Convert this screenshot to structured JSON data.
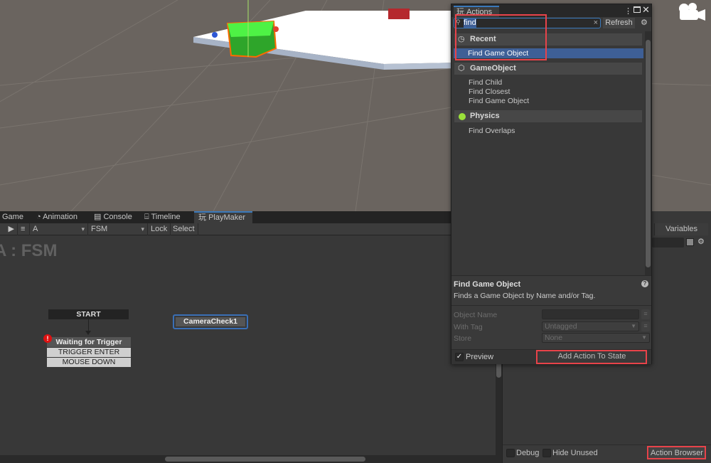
{
  "scene": {
    "camera_icon": "camera-gizmo-icon"
  },
  "bottom_tabs": [
    {
      "label": "Game",
      "icon": ""
    },
    {
      "label": "Animation",
      "icon": "clock-icon"
    },
    {
      "label": "Console",
      "icon": "console-icon"
    },
    {
      "label": "Timeline",
      "icon": "film-icon"
    },
    {
      "label": "PlayMaker",
      "icon": "playmaker-icon",
      "active": true
    }
  ],
  "toolbar": {
    "gameobject": "A",
    "fsm": "FSM",
    "lock": "Lock",
    "select": "Select"
  },
  "graph": {
    "title": "A : FSM",
    "start_label": "START",
    "states": [
      {
        "name": "Waiting for Trigger",
        "has_error": true,
        "transitions": [
          "TRIGGER ENTER",
          "MOUSE DOWN"
        ]
      },
      {
        "name": "CameraCheck1",
        "selected": true
      }
    ]
  },
  "inspector": {
    "variables_tab": "Variables",
    "debug": "Debug",
    "hide_unused": "Hide Unused",
    "action_browser": "Action Browser"
  },
  "actions_window": {
    "title": "Actions",
    "search_value": "find",
    "refresh": "Refresh",
    "categories": [
      {
        "name": "Recent",
        "icon": "clock-icon",
        "items": [
          "Find Game Object"
        ],
        "selected": 0
      },
      {
        "name": "GameObject",
        "icon": "cube-icon",
        "items": [
          "Find Child",
          "Find Closest",
          "Find Game Object"
        ]
      },
      {
        "name": "Physics",
        "icon": "physics-icon",
        "items": [
          "Find Overlaps"
        ]
      }
    ],
    "preview": {
      "title": "Find Game Object",
      "description": "Finds a Game Object by Name and/or Tag.",
      "fields": [
        {
          "label": "Object Name",
          "value": ""
        },
        {
          "label": "With Tag",
          "value": "Untagged"
        },
        {
          "label": "Store",
          "value": "None"
        }
      ]
    },
    "preview_checkbox": "Preview",
    "add_button": "Add Action To State"
  },
  "colors": {
    "highlight_box": "#e8434a",
    "selection": "#3e5f96",
    "accent": "#3a79bb"
  }
}
